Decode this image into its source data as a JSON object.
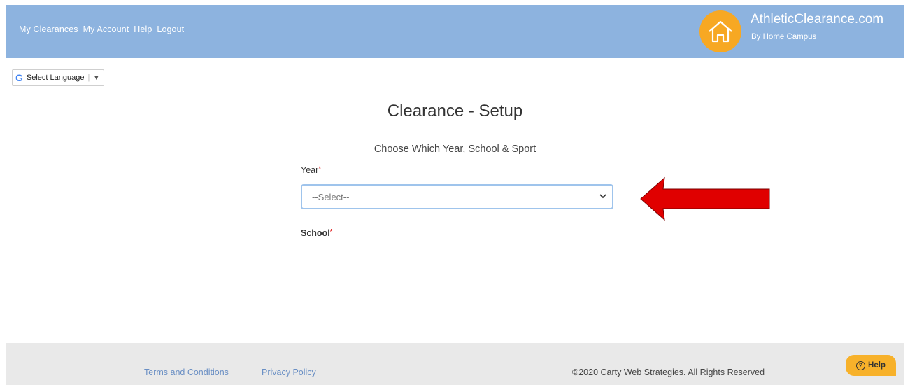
{
  "header": {
    "nav": [
      "My Clearances",
      "My Account",
      "Help",
      "Logout"
    ],
    "brand_title": "AthleticClearance.com",
    "brand_subtitle": "By Home Campus",
    "logo_icon": "house-icon",
    "background_color": "#8db3df",
    "logo_color": "#f7a823"
  },
  "language": {
    "label": "Select Language",
    "icon": "google-icon"
  },
  "main": {
    "title": "Clearance - Setup",
    "subtitle": "Choose Which Year, School & Sport",
    "year_label": "Year",
    "year_select_value": "--Select--",
    "school_label": "School",
    "required_mark": "*",
    "annotation_arrow_color": "#e00000"
  },
  "footer": {
    "terms": "Terms and Conditions",
    "privacy": "Privacy Policy",
    "copyright": "©2020 Carty Web Strategies. All Rights Reserved",
    "help_button": "Help"
  }
}
